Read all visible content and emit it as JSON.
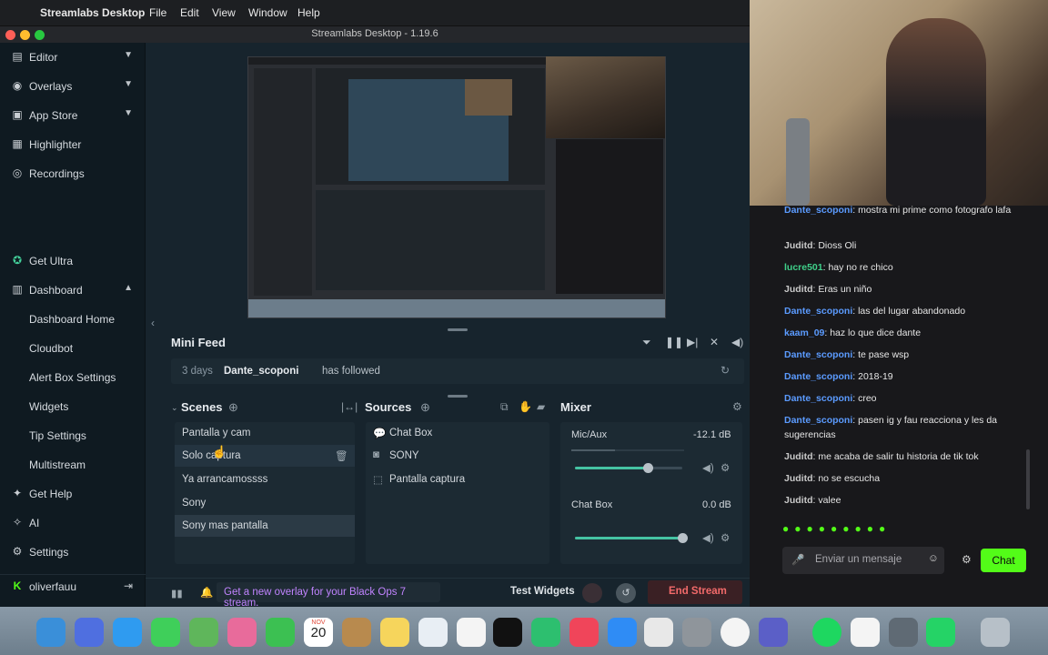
{
  "menubar": {
    "app": "Streamlabs Desktop",
    "items": [
      "File",
      "Edit",
      "View",
      "Window",
      "Help"
    ]
  },
  "window": {
    "title": "Streamlabs Desktop - 1.19.6"
  },
  "sidebar": {
    "items": [
      {
        "label": "Editor",
        "icon": "editor-icon"
      },
      {
        "label": "Overlays",
        "icon": "overlays-icon"
      },
      {
        "label": "App Store",
        "icon": "store-icon"
      },
      {
        "label": "Highlighter",
        "icon": "highlighter-icon"
      },
      {
        "label": "Recordings",
        "icon": "recordings-icon"
      },
      {
        "label": "Get Ultra",
        "icon": "ultra-icon"
      },
      {
        "label": "Dashboard",
        "icon": "dashboard-icon"
      },
      {
        "label": "Dashboard Home"
      },
      {
        "label": "Cloudbot"
      },
      {
        "label": "Alert Box Settings"
      },
      {
        "label": "Widgets"
      },
      {
        "label": "Tip Settings"
      },
      {
        "label": "Multistream"
      },
      {
        "label": "Get Help",
        "icon": "help-icon"
      },
      {
        "label": "AI",
        "icon": "ai-icon"
      },
      {
        "label": "Settings",
        "icon": "settings-icon"
      }
    ],
    "user": "oliverfauu"
  },
  "minifeed": {
    "title": "Mini Feed",
    "time": "3 days",
    "user": "Dante_scoponi",
    "action": "has followed"
  },
  "scenes": {
    "title": "Scenes",
    "items": [
      "Pantalla y cam",
      "Solo captura",
      "Ya arrancamossss",
      "Sony",
      "Sony mas pantalla"
    ]
  },
  "sources": {
    "title": "Sources",
    "items": [
      "Chat Box",
      "SONY",
      "Pantalla captura"
    ]
  },
  "mixer": {
    "title": "Mixer",
    "channels": [
      {
        "name": "Mic/Aux",
        "db": "-12.1 dB",
        "level": 0.68
      },
      {
        "name": "Chat Box",
        "db": "0.0 dB",
        "level": 1.0
      }
    ]
  },
  "bottom": {
    "promo": "Get a new overlay for your Black Ops 7 stream.",
    "test": "Test Widgets",
    "end": "End Stream"
  },
  "chat": {
    "messages": [
      {
        "user": "Dante_scoponi",
        "text": ": mostra mi prime como fotografo lafa",
        "color": "#5b9bff"
      },
      {
        "user": "Juditd",
        "text": ": Dioss Oli",
        "color": "#c9c9c9"
      },
      {
        "user": "lucre501",
        "text": ": hay no re chico",
        "color": "#3fd08a"
      },
      {
        "user": "Juditd",
        "text": ": Eras un niño",
        "color": "#c9c9c9"
      },
      {
        "user": "Dante_scoponi",
        "text": ": las del lugar abandonado",
        "color": "#5b9bff"
      },
      {
        "user": "kaam_09",
        "text": ": haz lo que dice dante",
        "color": "#5b9bff"
      },
      {
        "user": "Dante_scoponi",
        "text": ": te pase wsp",
        "color": "#5b9bff"
      },
      {
        "user": "Dante_scoponi",
        "text": ": 2018-19",
        "color": "#5b9bff"
      },
      {
        "user": "Dante_scoponi",
        "text": ": creo",
        "color": "#5b9bff"
      },
      {
        "user": "Dante_scoponi",
        "text": ": pasen ig y fau reacciona y les da sugerencias",
        "color": "#5b9bff"
      },
      {
        "user": "Juditd",
        "text": ": me acaba de salir tu historia de tik tok",
        "color": "#c9c9c9"
      },
      {
        "user": "Juditd",
        "text": ": no se escucha",
        "color": "#c9c9c9"
      },
      {
        "user": "Juditd",
        "text": ": valee",
        "color": "#c9c9c9"
      }
    ],
    "placeholder": "Enviar un mensaje",
    "send": "Chat"
  },
  "dock": {
    "calendar_month": "NOV",
    "calendar_day": "20"
  }
}
